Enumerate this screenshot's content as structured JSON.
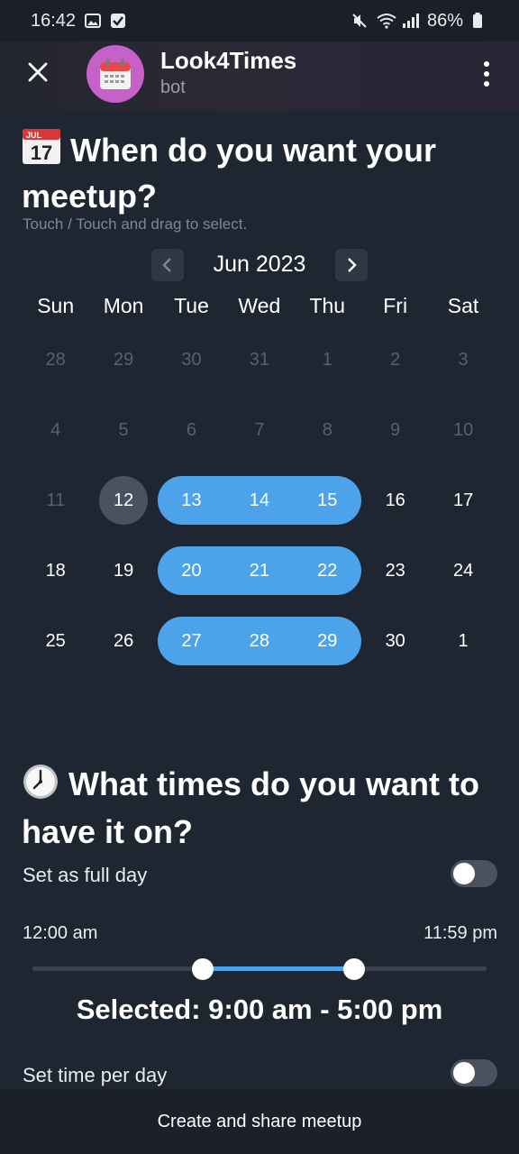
{
  "status": {
    "time": "16:42",
    "battery": "86%"
  },
  "header": {
    "bot_name": "Look4Times",
    "bot_subtitle": "bot"
  },
  "date_section": {
    "title": "When do you want your meetup?",
    "hint": "Touch / Touch and drag to select.",
    "month": "Jun 2023",
    "weekdays": [
      "Sun",
      "Mon",
      "Tue",
      "Wed",
      "Thu",
      "Fri",
      "Sat"
    ],
    "weeks": [
      [
        "28",
        "29",
        "30",
        "31",
        "1",
        "2",
        "3"
      ],
      [
        "4",
        "5",
        "6",
        "7",
        "8",
        "9",
        "10"
      ],
      [
        "11",
        "12",
        "13",
        "14",
        "15",
        "16",
        "17"
      ],
      [
        "18",
        "19",
        "20",
        "21",
        "22",
        "23",
        "24"
      ],
      [
        "25",
        "26",
        "27",
        "28",
        "29",
        "30",
        "1"
      ]
    ],
    "selected_dates": [
      "13",
      "14",
      "15",
      "20",
      "21",
      "22",
      "27",
      "28",
      "29"
    ],
    "current_day": "12"
  },
  "time_section": {
    "title": "What times do you want to have it on?",
    "full_day_label": "Set as full day",
    "full_day_on": false,
    "range_start_label": "12:00 am",
    "range_end_label": "11:59 pm",
    "slider_start_fraction": 0.375,
    "slider_end_fraction": 0.708,
    "selected_text": "Selected: 9:00 am - 5:00 pm",
    "per_day_label": "Set time per day",
    "per_day_on": false
  },
  "footer": {
    "create_label": "Create and share meetup"
  },
  "colors": {
    "accent": "#4ca3ea",
    "background": "#1e2632",
    "today": "#4a5262"
  }
}
